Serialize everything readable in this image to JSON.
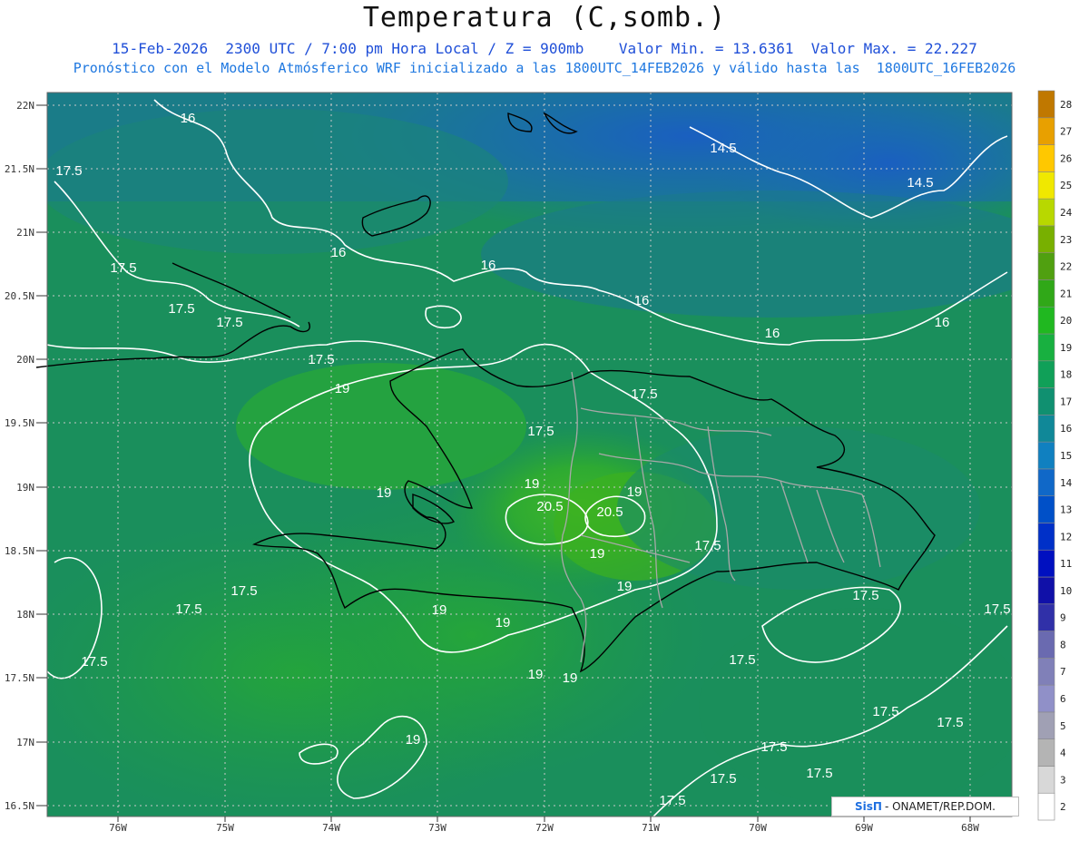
{
  "header": {
    "title": "Temperatura (C,somb.)",
    "line1": "15-Feb-2026  2300 UTC / 7:00 pm Hora Local / Z = 900mb    Valor Min. = 13.6361  Valor Max. = 22.227",
    "line2": "Pronóstico con el Modelo Atmósferico WRF inicializado a las 1800UTC_14FEB2026 y válido hasta las  1800UTC_16FEB2026"
  },
  "axes": {
    "lat_labels": [
      "22N",
      "21.5N",
      "21N",
      "20.5N",
      "20N",
      "19.5N",
      "19N",
      "18.5N",
      "18N",
      "17.5N",
      "17N",
      "16.5N"
    ],
    "lon_labels": [
      "76W",
      "75W",
      "74W",
      "73W",
      "72W",
      "71W",
      "70W",
      "69W",
      "68W"
    ]
  },
  "colorbar": {
    "labels": [
      "2",
      "3",
      "4",
      "5",
      "6",
      "7",
      "8",
      "9",
      "10",
      "11",
      "12",
      "13",
      "14",
      "15",
      "16",
      "17",
      "18",
      "19",
      "20",
      "21",
      "22",
      "23",
      "24",
      "25",
      "26",
      "27",
      "28"
    ],
    "colors": [
      "#ffffff",
      "#d8d8d8",
      "#b4b4b4",
      "#a0a0b4",
      "#9090c8",
      "#8080b8",
      "#6a6ab0",
      "#3030a8",
      "#1010a8",
      "#0010c0",
      "#0030c8",
      "#0050c8",
      "#1068c8",
      "#1080c0",
      "#108898",
      "#109070",
      "#10a058",
      "#18b040",
      "#20b820",
      "#30a818",
      "#50a010",
      "#78b000",
      "#b8d800",
      "#f0e800",
      "#ffc800",
      "#e8a000",
      "#c07800"
    ]
  },
  "contours": {
    "labels": [
      "14.5",
      "14.5",
      "16",
      "16",
      "16",
      "16",
      "16",
      "16",
      "17.5",
      "17.5",
      "17.5",
      "17.5",
      "17.5",
      "17.5",
      "17.5",
      "17.5",
      "17.5",
      "17.5",
      "17.5",
      "17.5",
      "17.5",
      "17.5",
      "17.5",
      "17.5",
      "19",
      "19",
      "19",
      "19",
      "19",
      "19",
      "19",
      "19",
      "19",
      "19",
      "19",
      "20.5",
      "20.5"
    ]
  },
  "credit": {
    "brand": "SisΠ",
    "text": "- ONAMET/REP.DOM."
  }
}
